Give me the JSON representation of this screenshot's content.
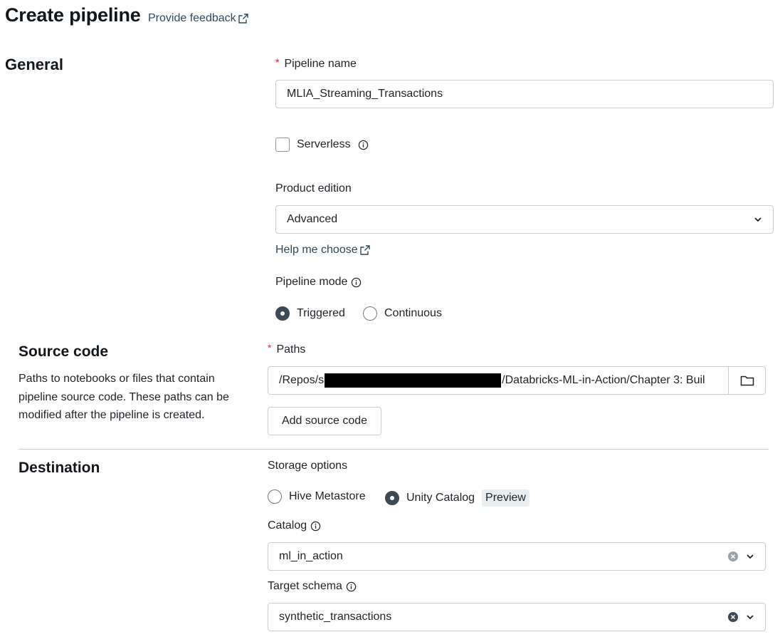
{
  "header": {
    "title": "Create pipeline",
    "feedback_link": "Provide feedback"
  },
  "general": {
    "section_title": "General",
    "pipeline_name": {
      "label": "Pipeline name",
      "required_mark": "*",
      "value": "MLIA_Streaming_Transactions"
    },
    "serverless": {
      "label": "Serverless",
      "checked": false
    },
    "product_edition": {
      "label": "Product edition",
      "value": "Advanced"
    },
    "help_link": "Help me choose",
    "pipeline_mode": {
      "label": "Pipeline mode",
      "options": [
        "Triggered",
        "Continuous"
      ],
      "selected": "Triggered"
    }
  },
  "source_code": {
    "section_title": "Source code",
    "description": "Paths to notebooks or files that contain pipeline source code. These paths can be modified after the pipeline is created.",
    "paths": {
      "label": "Paths",
      "required_mark": "*",
      "value_prefix": "/Repos/",
      "value_partial_char": "s",
      "value_suffix": "/Databricks-ML-in-Action/Chapter 3: Buil"
    },
    "add_button": "Add source code"
  },
  "destination": {
    "section_title": "Destination",
    "storage_options": {
      "label": "Storage options",
      "options": [
        "Hive Metastore",
        "Unity Catalog"
      ],
      "selected": "Unity Catalog",
      "badge": "Preview"
    },
    "catalog": {
      "label": "Catalog",
      "value": "ml_in_action"
    },
    "target_schema": {
      "label": "Target schema",
      "value": "synthetic_transactions"
    }
  },
  "icons": {
    "external_link": "external-link-icon",
    "info": "info-icon",
    "chevron": "chevron-down-icon",
    "folder": "folder-icon",
    "clear": "clear-icon"
  },
  "colors": {
    "link": "#2f4a5c",
    "required": "#e0242b",
    "radio_selected": "#3d4a55",
    "border": "#c8cfd4"
  }
}
